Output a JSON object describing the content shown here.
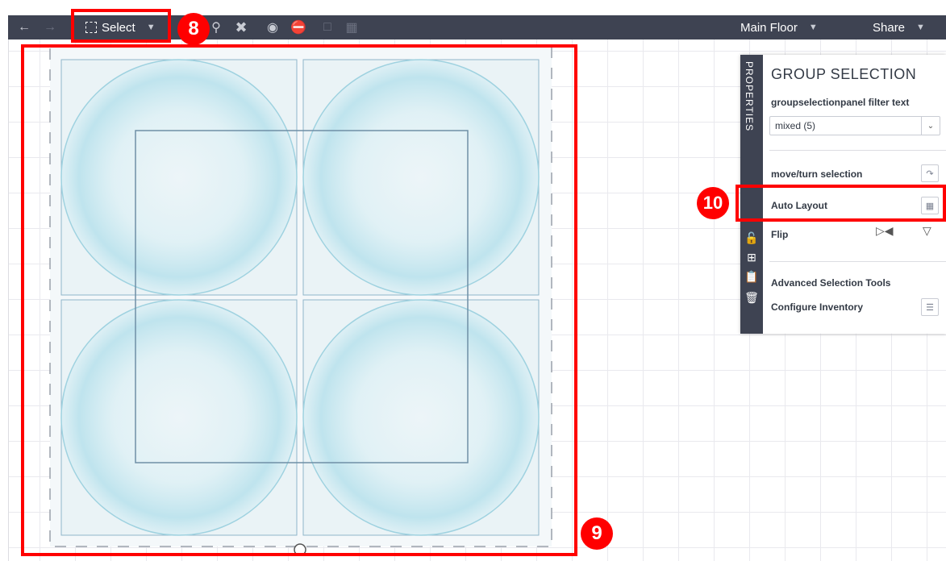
{
  "toolbar": {
    "back_icon": "arrow-left-icon",
    "forward_icon": "arrow-right-icon",
    "select_label": "Select",
    "floor_label": "Main Floor",
    "share_label": "Share"
  },
  "annotations": {
    "badge_8": "8",
    "badge_9": "9",
    "badge_10": "10"
  },
  "panel": {
    "tab_label": "PROPERTIES",
    "title": "GROUP SELECTION",
    "filter_label": "groupselectionpanel filter text",
    "filter_value": "mixed (5)",
    "move_turn_label": "move/turn selection",
    "auto_layout_label": "Auto Layout",
    "flip_label": "Flip",
    "advanced_label": "Advanced Selection Tools",
    "configure_label": "Configure Inventory"
  },
  "colors": {
    "toolbar_bg": "#3e4352",
    "highlight": "#ff0000",
    "selection_fill": "#eef5f8",
    "circle_fill": "#bfe3ee"
  }
}
